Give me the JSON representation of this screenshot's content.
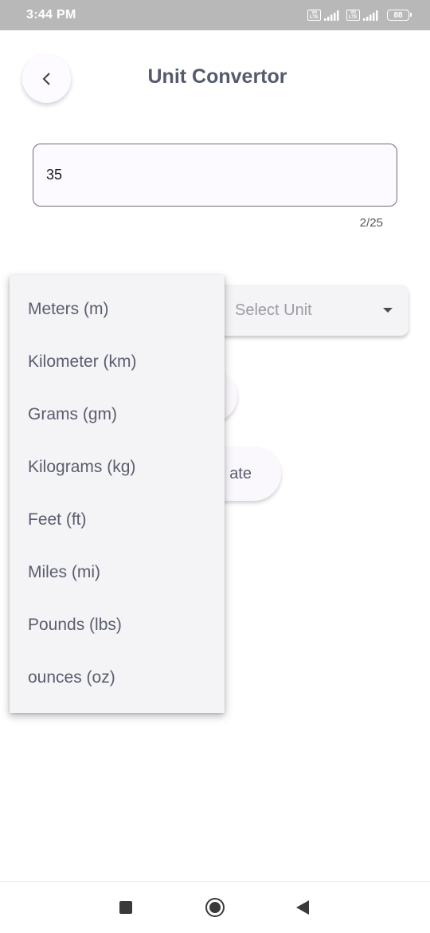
{
  "status_bar": {
    "time": "3:44 PM",
    "sim_badge_top": "Vo",
    "sim_badge_bottom": "LTE",
    "battery": "88"
  },
  "header": {
    "title": "Unit Convertor",
    "back_icon": "chevron-left-icon"
  },
  "input": {
    "value": "35",
    "counter": "2/25"
  },
  "to_unit": {
    "placeholder": "Select Unit"
  },
  "calculate": {
    "label": "ate"
  },
  "unit_menu": {
    "items": [
      "Meters (m)",
      "Kilometer (km)",
      "Grams (gm)",
      "Kilograms (kg)",
      "Feet (ft)",
      "Miles (mi)",
      "Pounds (lbs)",
      "ounces (oz)"
    ]
  },
  "nav_bar": {
    "recents_icon": "square-icon",
    "home_icon": "circle-icon",
    "back_icon": "triangle-back-icon"
  },
  "colors": {
    "accent_text": "#555a6c",
    "status_bar": "#b8b8b8",
    "menu_background": "#f4f4f6"
  }
}
